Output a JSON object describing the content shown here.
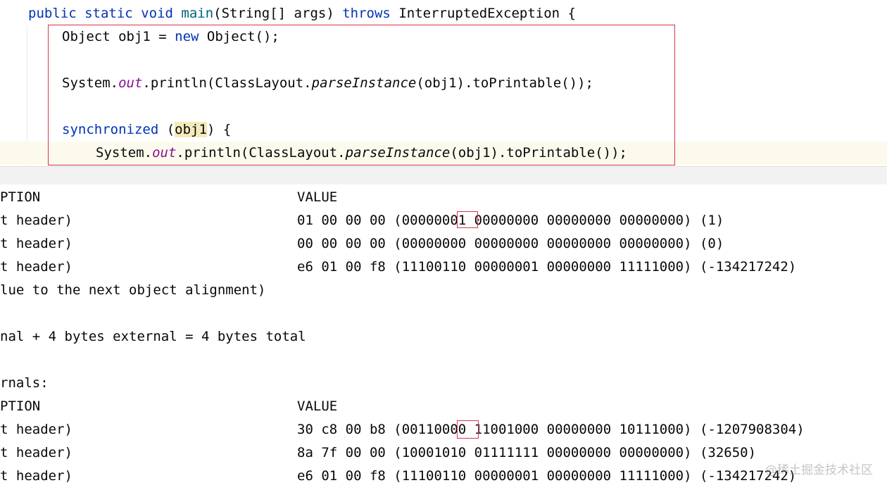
{
  "editor": {
    "line_main": [
      "public",
      "static",
      "void",
      "main",
      "(String[] args)",
      "throws",
      "InterruptedException {"
    ],
    "line_obj": [
      "Object obj1 = ",
      "new",
      " Object();"
    ],
    "line_print1": [
      "System.",
      "out",
      ".println(ClassLayout.",
      "parseInstance",
      "(obj1).toPrintable());"
    ],
    "line_sync": [
      "synchronized",
      " (",
      "obj1",
      ") {"
    ],
    "line_print2": [
      "System.",
      "out",
      ".println(ClassLayout.",
      "parseInstance",
      "(obj1).toPrintable());"
    ]
  },
  "console": {
    "rows": [
      {
        "left": "PTION",
        "right": "VALUE"
      },
      {
        "left": "t header)",
        "right_pre": "01 00 00 00 (000000",
        "right_box": "01",
        "right_post": " 00000000 00000000 00000000) (1)"
      },
      {
        "left": "t header)",
        "right": "00 00 00 00 (00000000 00000000 00000000 00000000) (0)"
      },
      {
        "left": "t header)",
        "right": "e6 01 00 f8 (11100110 00000001 00000000 11111000) (-134217242)"
      },
      {
        "left": "lue to the next object alignment)",
        "right": ""
      },
      {
        "left": "",
        "right": ""
      },
      {
        "left": "nal + 4 bytes external = 4 bytes total",
        "right": ""
      },
      {
        "left": "",
        "right": ""
      },
      {
        "left": "rnals:",
        "right": ""
      },
      {
        "left": "PTION",
        "right": "VALUE"
      },
      {
        "left": "t header)",
        "right_pre": "30 c8 00 b8 (001100",
        "right_box": "00",
        "right_post": " 11001000 00000000 10111000) (-1207908304)"
      },
      {
        "left": "t header)",
        "right": "8a 7f 00 00 (10001010 01111111 00000000 00000000) (32650)"
      },
      {
        "left": "t header)",
        "right": "e6 01 00 f8 (11100110 00000001 00000000 11111000) (-134217242)"
      }
    ]
  },
  "watermark": "@稀土掘金技术社区",
  "colors": {
    "keyword": "#0033b3",
    "method": "#00627a",
    "static_field": "#871094",
    "highlight_box": "#d8344d"
  }
}
